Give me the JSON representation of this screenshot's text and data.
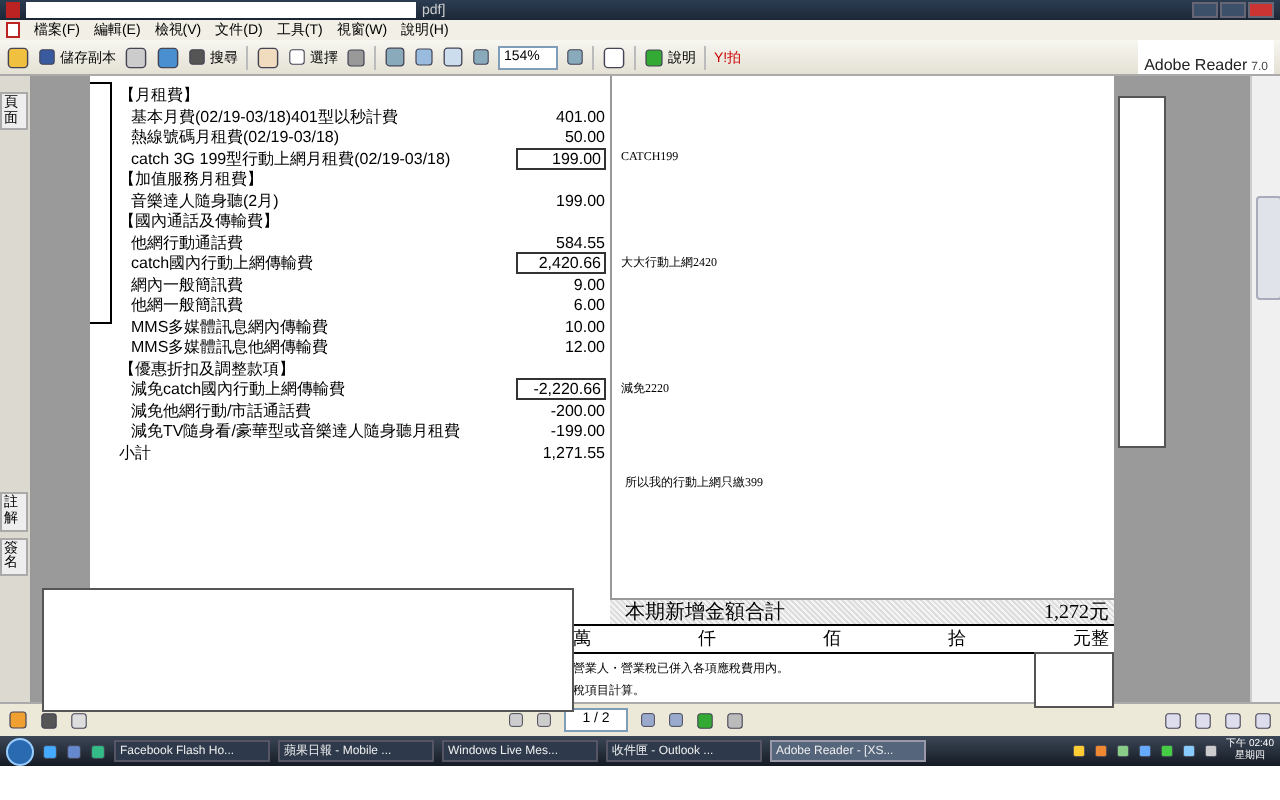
{
  "window": {
    "title": "pdf]"
  },
  "menu": [
    "檔案(F)",
    "編輯(E)",
    "檢視(V)",
    "文件(D)",
    "工具(T)",
    "視窗(W)",
    "說明(H)"
  ],
  "toolbar": {
    "save_copy": "儲存副本",
    "search": "搜尋",
    "select": "選擇",
    "zoom": "154%",
    "help": "說明",
    "yahoo": "Y!拍"
  },
  "brand": {
    "name": "Adobe Reader",
    "version": "7.0"
  },
  "side_tabs_top": [
    "頁面"
  ],
  "side_tabs_bottom": [
    "註解",
    "簽名"
  ],
  "bill": [
    {
      "kind": "header",
      "label": "【月租費】"
    },
    {
      "kind": "item",
      "label": "基本月費(02/19-03/18)401型以秒計費",
      "amount": "401.00",
      "boxed": false
    },
    {
      "kind": "item",
      "label": "熱線號碼月租費(02/19-03/18)",
      "amount": "50.00",
      "boxed": false
    },
    {
      "kind": "item",
      "label": "catch 3G 199型行動上網月租費(02/19-03/18)",
      "amount": "199.00",
      "boxed": true,
      "note": "CATCH199"
    },
    {
      "kind": "header",
      "label": "【加值服務月租費】"
    },
    {
      "kind": "item",
      "label": "音樂達人隨身聽(2月)",
      "amount": "199.00",
      "boxed": false
    },
    {
      "kind": "header",
      "label": "【國內通話及傳輸費】"
    },
    {
      "kind": "item",
      "label": "他網行動通話費",
      "amount": "584.55",
      "boxed": false
    },
    {
      "kind": "item",
      "label": "catch國內行動上網傳輸費",
      "amount": "2,420.66",
      "boxed": true,
      "note": "大大行動上網2420"
    },
    {
      "kind": "item",
      "label": "網內一般簡訊費",
      "amount": "9.00",
      "boxed": false
    },
    {
      "kind": "item",
      "label": "他網一般簡訊費",
      "amount": "6.00",
      "boxed": false
    },
    {
      "kind": "item",
      "label": "MMS多媒體訊息網內傳輸費",
      "amount": "10.00",
      "boxed": false
    },
    {
      "kind": "item",
      "label": "MMS多媒體訊息他網傳輸費",
      "amount": "12.00",
      "boxed": false
    },
    {
      "kind": "header",
      "label": "【優惠折扣及調整款項】"
    },
    {
      "kind": "item",
      "label": "減免catch國內行動上網傳輸費",
      "amount": "-2,220.66",
      "boxed": true,
      "note": "減免2220"
    },
    {
      "kind": "item",
      "label": "減免他網行動/市話通話費",
      "amount": "-200.00",
      "boxed": false
    },
    {
      "kind": "item",
      "label": "減免TV隨身看/豪華型或音樂達人隨身聽月租費",
      "amount": "-199.00",
      "boxed": false
    },
    {
      "kind": "subtotal",
      "label": "小計",
      "amount": "1,271.55",
      "boxed": false
    }
  ],
  "summary_note": "所以我的行動上網只繳399",
  "total": {
    "label": "本期新增金額合計",
    "amount": "1,272元"
  },
  "digits": [
    "萬",
    "仟",
    "佰",
    "拾",
    "元整"
  ],
  "footnotes": [
    "營業人・營業稅已併入各項應稅費用內。",
    "稅項目計算。"
  ],
  "page_nav": {
    "page": "1 / 2"
  },
  "taskbar": [
    {
      "label": "Facebook Flash Ho...",
      "selected": false
    },
    {
      "label": "蘋果日報 - Mobile ...",
      "selected": false
    },
    {
      "label": "Windows Live Mes...",
      "selected": false
    },
    {
      "label": "收件匣 - Outlook ...",
      "selected": false
    },
    {
      "label": "Adobe Reader - [XS...",
      "selected": true
    }
  ],
  "clock": {
    "time": "下午 02:40",
    "day": "星期四"
  }
}
